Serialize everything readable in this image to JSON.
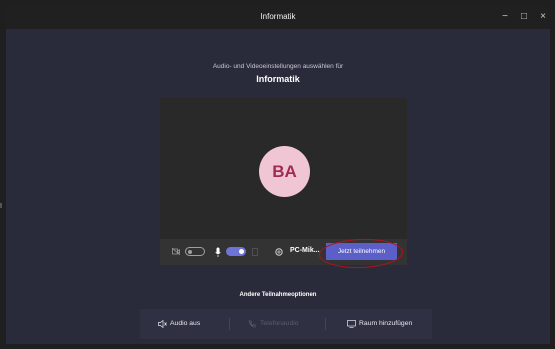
{
  "window": {
    "title": "Informatik",
    "controls": {
      "minimize": "−",
      "maximize": "□",
      "close": "×"
    }
  },
  "header": {
    "subtitle": "Audio- und Videoeinstellungen auswählen für",
    "meeting_name": "Informatik"
  },
  "preview": {
    "avatar_initials": "BA",
    "camera_toggle": "off",
    "mic_toggle": "on",
    "device_label": "PC-Mik...",
    "join_label": "Jetzt teilnehmen"
  },
  "other_options": {
    "heading": "Andere Teilnahmeoptionen",
    "audio_off": "Audio aus",
    "phone_audio": "Telefonaudio",
    "add_room": "Raum hinzufügen"
  },
  "colors": {
    "background": "#292a3a",
    "accent": "#5b5fc7",
    "avatar_bg": "#f1c6d4",
    "avatar_text": "#a02c55",
    "annotation": "#b3121f"
  }
}
